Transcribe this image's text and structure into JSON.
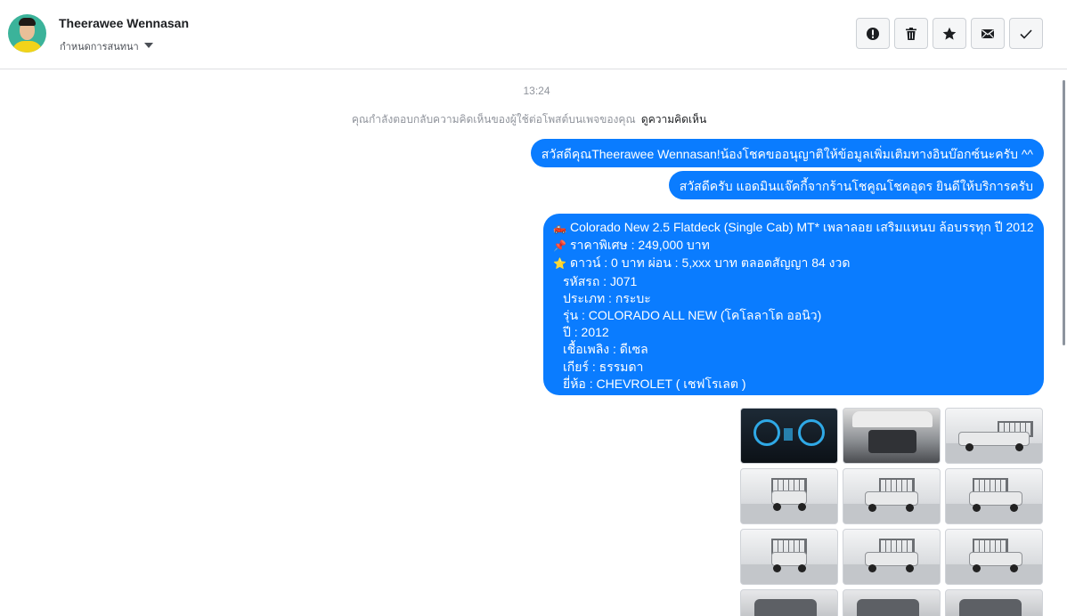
{
  "header": {
    "contact_name": "Theerawee Wennasan",
    "contact_sub": "กำหนดการสนทนา",
    "actions": [
      {
        "name": "mark-spam",
        "icon": "exclamation-circle-icon"
      },
      {
        "name": "delete",
        "icon": "trash-icon"
      },
      {
        "name": "star",
        "icon": "star-icon"
      },
      {
        "name": "mark-unread",
        "icon": "envelope-icon"
      },
      {
        "name": "mark-done",
        "icon": "check-icon"
      }
    ]
  },
  "thread": {
    "timestamp": "13:24",
    "notice": {
      "text": "คุณกำลังตอบกลับความคิดเห็นของผู้ใช้ต่อโพสต์บนเพจของคุณ",
      "link": "ดูความคิดเห็น"
    },
    "messages": [
      {
        "text": "สวัสดีคุณTheerawee Wennasan!น้องโชคขออนุญาติให้ข้อมูลเพิ่มเติมทางอินบ๊อกซ์นะครับ ^^"
      },
      {
        "text": "สวัสดีครับ แอดมินแจ๊คกี้จากร้านโชคูณโชคอุดร ยินดีให้บริการครับ"
      }
    ],
    "listing": {
      "lines": [
        {
          "icon": "🛻",
          "text": "Colorado New 2.5 Flatdeck (Single Cab) MT* เพลาลอย เสริมแหนบ ล้อบรรทุก  ปี 2012"
        },
        {
          "icon": "📌",
          "text": "ราคาพิเศษ : 249,000 บาท"
        },
        {
          "icon": "⭐",
          "text": "ดาวน์ : 0 บาท ผ่อน : 5,xxx บาท ตลอดสัญญา 84 งวด"
        },
        {
          "icon": "",
          "text": "รหัสรถ : J071"
        },
        {
          "icon": "",
          "text": "ประเภท : กระบะ"
        },
        {
          "icon": "",
          "text": "รุ่น : COLORADO ALL NEW (โคโลลาโด ออนิว)"
        },
        {
          "icon": "",
          "text": "ปี : 2012"
        },
        {
          "icon": "",
          "text": "เชื้อเพลิง : ดีเซล"
        },
        {
          "icon": "",
          "text": "เกียร์ : ธรรมดา"
        },
        {
          "icon": "",
          "text": "ยี่ห้อ : CHEVROLET ( เชฟโรเลต )"
        }
      ]
    },
    "photos": [
      {
        "name": "photo-dashboard",
        "kind": "dash"
      },
      {
        "name": "photo-engine",
        "kind": "engine"
      },
      {
        "name": "photo-side-view",
        "kind": "side"
      },
      {
        "name": "photo-front-view",
        "kind": "front"
      },
      {
        "name": "photo-front-angle",
        "kind": "frontangle"
      },
      {
        "name": "photo-rear-angle",
        "kind": "rearangle"
      },
      {
        "name": "photo-rear-view",
        "kind": "rear"
      },
      {
        "name": "photo-front-angle-2",
        "kind": "frontangle"
      },
      {
        "name": "photo-side-angle",
        "kind": "rearangle"
      },
      {
        "name": "photo-interior-1",
        "kind": "interior"
      },
      {
        "name": "photo-interior-2",
        "kind": "interior"
      },
      {
        "name": "photo-interior-3",
        "kind": "interior"
      }
    ]
  },
  "colors": {
    "bubble": "#0a7cff",
    "muted_text": "#90949c",
    "border": "#dddfe2"
  }
}
